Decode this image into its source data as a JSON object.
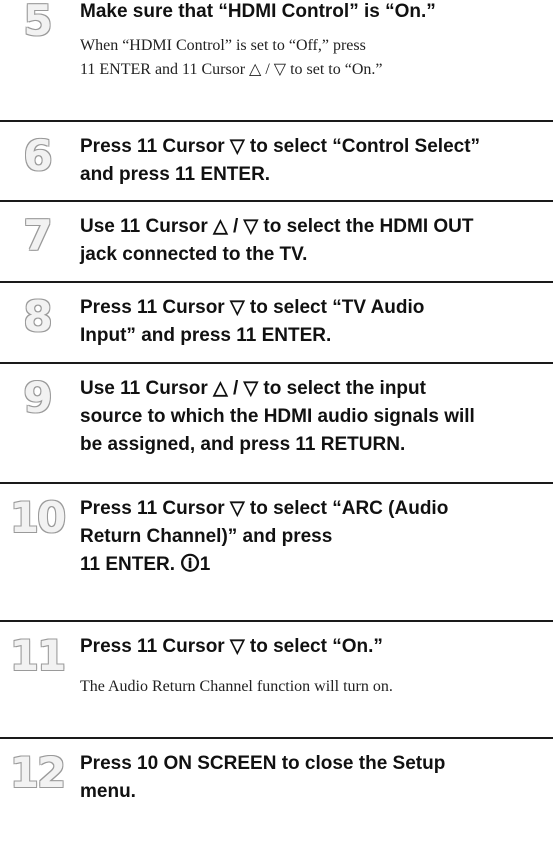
{
  "steps": [
    {
      "number": "5",
      "title": "Make sure that “HDMI Control” is “On.”",
      "note": "When “HDMI Control” is set to “Off,” press\n11 ENTER and 11 Cursor △ / ▽ to set to “On.”"
    },
    {
      "number": "6",
      "title": "Press 11 Cursor ▽ to select “Control Select”\nand press 11 ENTER."
    },
    {
      "number": "7",
      "title": "Use 11 Cursor △ / ▽ to select the HDMI OUT\njack connected to the TV."
    },
    {
      "number": "8",
      "title": "Press 11 Cursor ▽ to select “TV Audio\nInput” and press 11 ENTER."
    },
    {
      "number": "9",
      "title": "Use 11 Cursor △ / ▽ to select the input\nsource to which the HDMI audio signals will\nbe assigned, and press 11 RETURN."
    },
    {
      "number": "10",
      "title": "Press 11 Cursor ▽ to select “ARC (Audio\nReturn Channel)” and press\n11 ENTER. 🛈1"
    },
    {
      "number": "11",
      "title": "Press 11 Cursor ▽ to select “On.”",
      "note": "The Audio Return Channel function will turn on."
    },
    {
      "number": "12",
      "title": "Press 10 ON SCREEN to close the Setup\nmenu."
    }
  ]
}
